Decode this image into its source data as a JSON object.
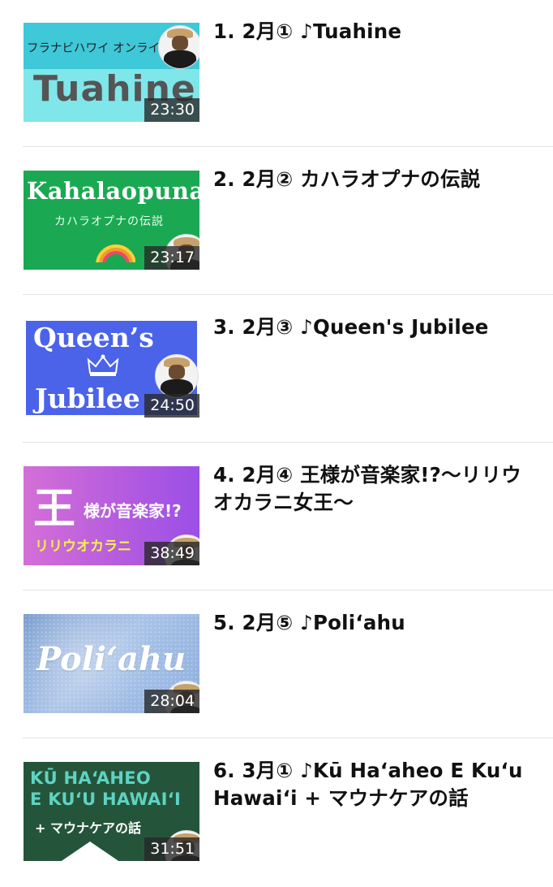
{
  "videos": [
    {
      "title": "1. 2月① ♪Tuahine",
      "duration": "23:30",
      "thumb": {
        "sub": "フラナビハワイ オンラインセミナー",
        "big": "Tuahine"
      }
    },
    {
      "title": "2. 2月② カハラオプナの伝説",
      "duration": "23:17",
      "thumb": {
        "big": "Kahalaopuna",
        "sub": "カハラオプナの伝説"
      }
    },
    {
      "title": "3. 2月③ ♪Queen's Jubilee",
      "duration": "24:50",
      "thumb": {
        "line1": "Queen’s",
        "line2": "Jubilee"
      }
    },
    {
      "title": "4. 2月④ 王様が音楽家!?〜リリウオカラニ女王〜",
      "duration": "38:49",
      "thumb": {
        "king": "王",
        "rest": "様が音楽家!?",
        "sub": "リリウオカラニ"
      }
    },
    {
      "title": "5. 2月⑤ ♪Poliʻahu",
      "duration": "28:04",
      "thumb": {
        "big": "Poliʻahu"
      }
    },
    {
      "title": "6. 3月① ♪Kū Haʻaheo E Kuʻu Hawaiʻi + マウナケアの話",
      "duration": "31:51",
      "thumb": {
        "line1": "KŪ HAʻAHEO",
        "line2": "E KUʻU HAWAIʻI",
        "sub": "+ マウナケアの話"
      }
    }
  ]
}
